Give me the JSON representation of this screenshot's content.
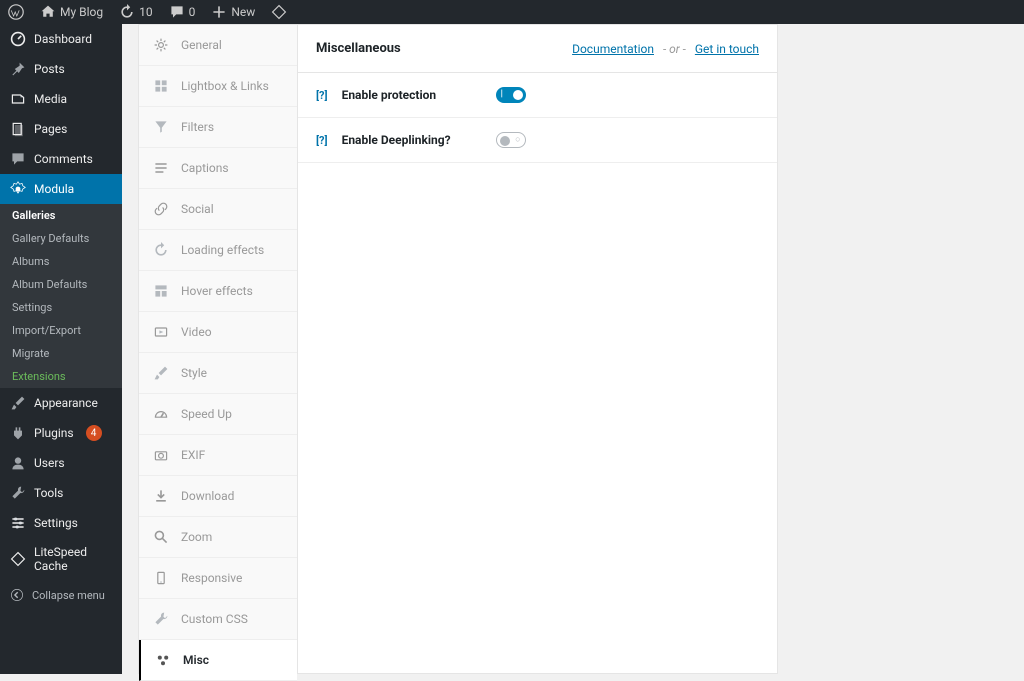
{
  "adminBar": {
    "site": "My Blog",
    "updates": "10",
    "comments": "0",
    "new": "New"
  },
  "sidebar": {
    "dashboard": "Dashboard",
    "posts": "Posts",
    "media": "Media",
    "pages": "Pages",
    "comments": "Comments",
    "modula": "Modula",
    "modulaSub": {
      "galleries": "Galleries",
      "galleryDefaults": "Gallery Defaults",
      "albums": "Albums",
      "albumDefaults": "Album Defaults",
      "settings": "Settings",
      "importExport": "Import/Export",
      "migrate": "Migrate",
      "extensions": "Extensions"
    },
    "appearance": "Appearance",
    "plugins": "Plugins",
    "pluginsBadge": "4",
    "users": "Users",
    "tools": "Tools",
    "settings": "Settings",
    "litespeed": "LiteSpeed Cache",
    "collapse": "Collapse menu"
  },
  "settingsTabs": {
    "general": "General",
    "lightbox": "Lightbox & Links",
    "filters": "Filters",
    "captions": "Captions",
    "social": "Social",
    "loading": "Loading effects",
    "hover": "Hover effects",
    "video": "Video",
    "style": "Style",
    "speedup": "Speed Up",
    "exif": "EXIF",
    "download": "Download",
    "zoom": "Zoom",
    "responsive": "Responsive",
    "customcss": "Custom CSS",
    "misc": "Misc"
  },
  "panel": {
    "title": "Miscellaneous",
    "doc": "Documentation",
    "or": "- or -",
    "contact": "Get in touch",
    "protection": "Enable protection",
    "deeplinking": "Enable Deeplinking?",
    "help": "[?]"
  }
}
